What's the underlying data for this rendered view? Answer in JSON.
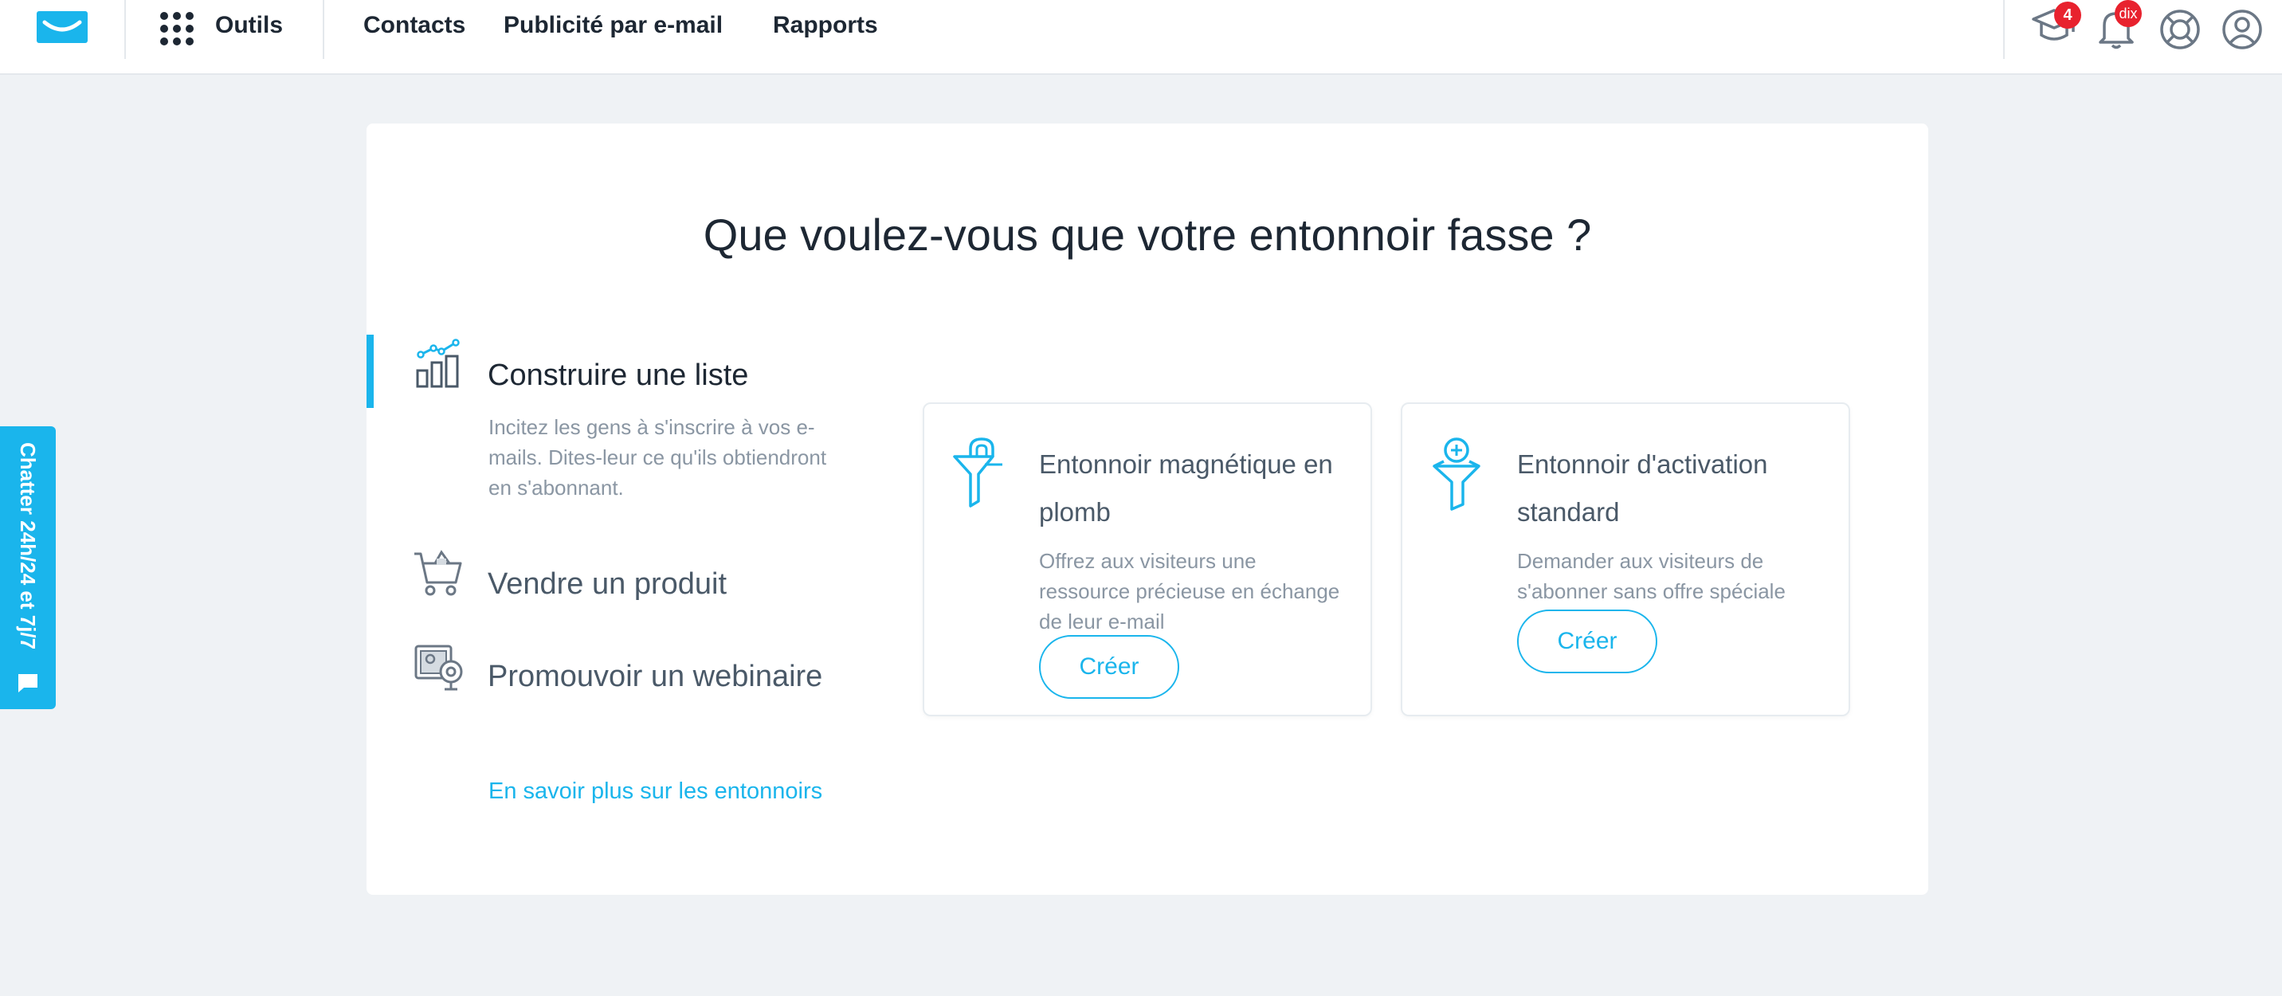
{
  "colors": {
    "accent": "#1ab5ec",
    "badge": "#e8222e",
    "background": "#eff2f5",
    "text": "#1d2733",
    "muted": "#8a96a3"
  },
  "topbar": {
    "logo_icon": "getresponse-envelope-logo",
    "tools_label": "Outils",
    "nav": [
      "Contacts",
      "Publicité par e-mail",
      "Rapports"
    ],
    "icons": [
      {
        "name": "graduation-cap-icon",
        "badge": "4"
      },
      {
        "name": "bell-icon",
        "badge": "dix"
      },
      {
        "name": "lifebuoy-icon",
        "badge": ""
      },
      {
        "name": "user-profile-icon",
        "badge": ""
      }
    ]
  },
  "chat": {
    "label": "Chatter 24h/24 et 7j/7",
    "icon": "chat-bubble-icon"
  },
  "main": {
    "heading": "Que voulez-vous que votre entonnoir fasse ?",
    "goals": [
      {
        "title": "Construire une liste",
        "icon": "bar-chart-growth-icon",
        "active": true,
        "description": "Incitez les gens à s'inscrire à vos e-mails. Dites-leur ce qu'ils obtiendront en s'abonnant."
      },
      {
        "title": "Vendre un produit",
        "icon": "shopping-cart-icon",
        "active": false
      },
      {
        "title": "Promouvoir un webinaire",
        "icon": "webinar-icon",
        "active": false
      }
    ],
    "learn_more": "En savoir plus sur les entonnoirs",
    "options": [
      {
        "icon": "magnet-funnel-icon",
        "title": "Entonnoir magnétique en plomb",
        "description": "Offrez aux visiteurs une ressource précieuse en échange de leur e-mail",
        "button": "Créer"
      },
      {
        "icon": "activation-funnel-icon",
        "title": "Entonnoir d'activation standard",
        "description": "Demander aux visiteurs de s'abonner sans offre spéciale",
        "button": "Créer"
      }
    ]
  }
}
